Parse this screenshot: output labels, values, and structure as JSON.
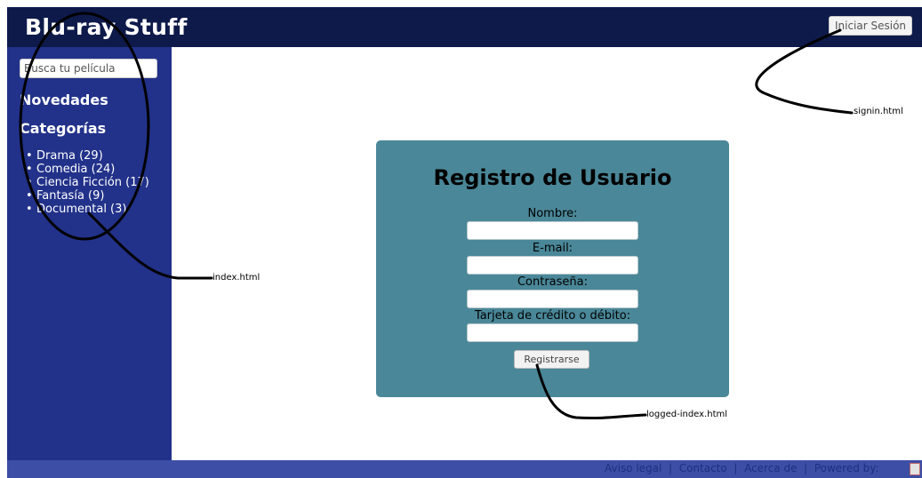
{
  "header": {
    "brand": "Blu-ray Stuff",
    "signin_label": "Iniciar Sesión"
  },
  "sidebar": {
    "search_placeholder": "Busca tu película",
    "novedades": "Novedades",
    "categorias": "Categorías",
    "categories": [
      "Drama (29)",
      "Comedia (24)",
      "Ciencia Ficción (17)",
      "Fantasía (9)",
      "Documental (3)"
    ]
  },
  "form": {
    "title": "Registro de Usuario",
    "labels": [
      "Nombre:",
      "E-mail:",
      "Contraseña:",
      "Tarjeta de crédito o débito:"
    ],
    "submit_label": "Registrarse"
  },
  "footer": {
    "links": [
      "Aviso legal",
      "Contacto",
      "Acerca de",
      "Powered by:"
    ]
  },
  "annotations": {
    "signin_target": "signin.html",
    "index_target": "index.html",
    "logged_target": "logged-index.html"
  }
}
